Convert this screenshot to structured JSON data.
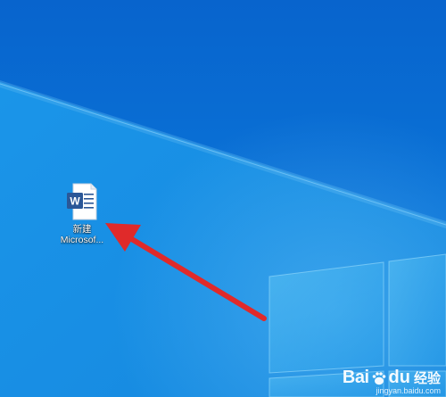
{
  "desktop": {
    "icons": [
      {
        "label_line1": "新建",
        "label_line2": "Microsof...",
        "icon": "word-document-icon",
        "icon_letter": "W"
      }
    ]
  },
  "annotation": {
    "arrow_color": "#e02a2a",
    "arrow_icon": "red-arrow-icon"
  },
  "watermark": {
    "brand_bai": "Bai",
    "brand_du": "du",
    "brand_cn": "经验",
    "url": "jingyan.baidu.com"
  },
  "colors": {
    "wallpaper_dark": "#0a6fd3",
    "wallpaper_light": "#1a8fe6",
    "word_blue": "#2b5797"
  }
}
